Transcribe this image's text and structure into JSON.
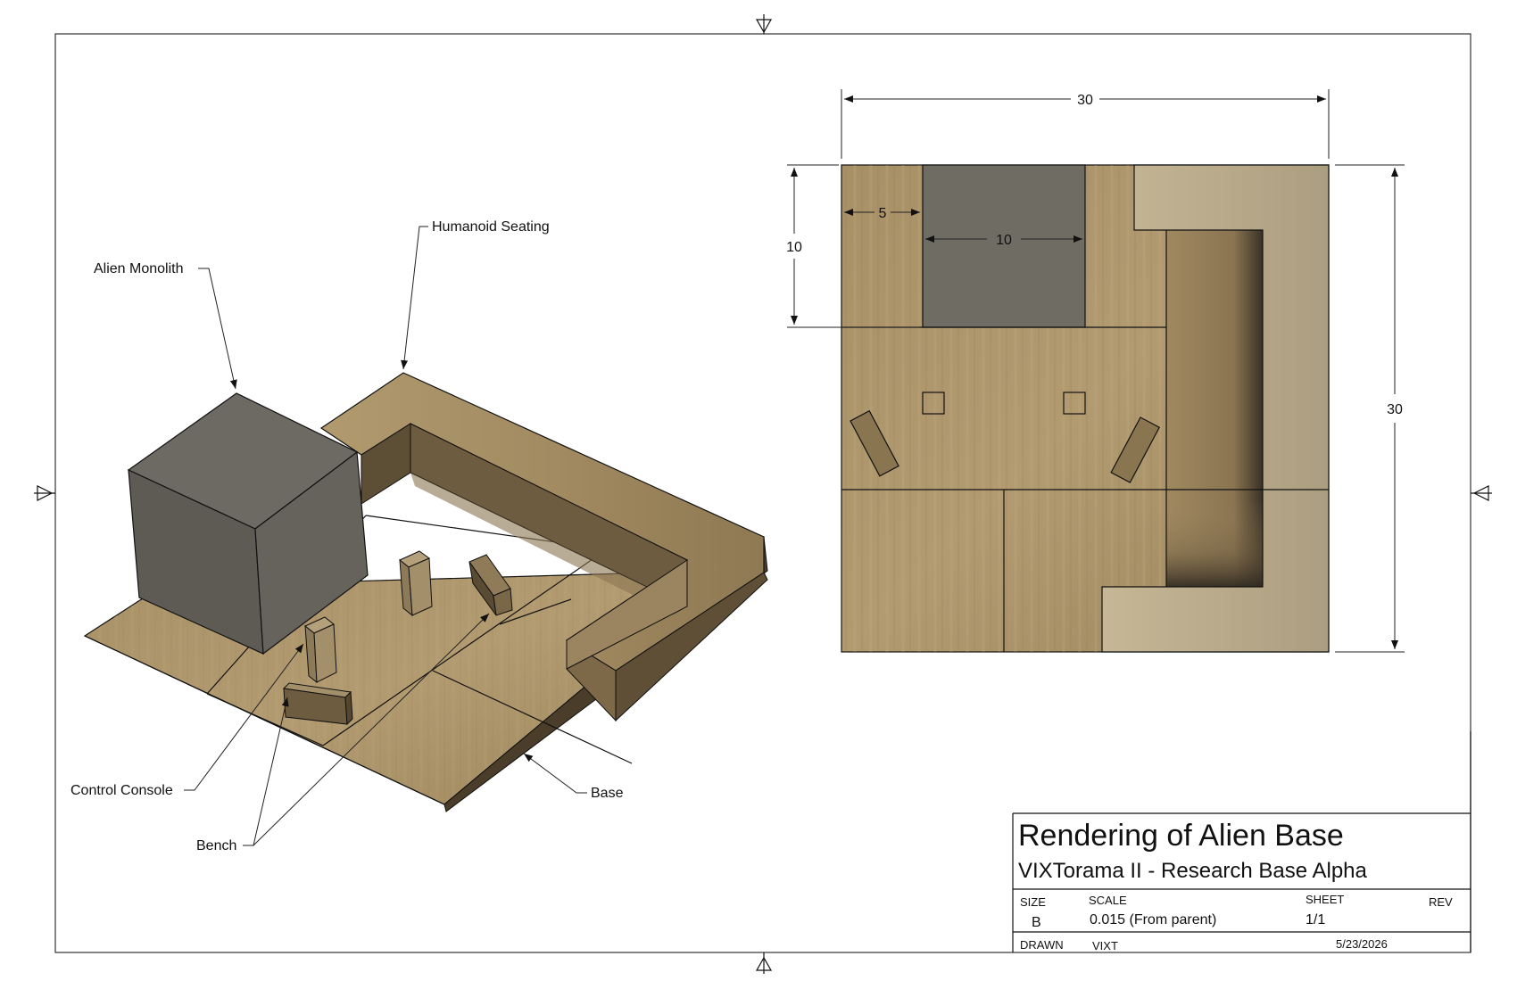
{
  "drawing": {
    "title": "Rendering of Alien Base",
    "subtitle": "VIXTorama II - Research Base Alpha"
  },
  "callouts": {
    "alien_monolith": "Alien Monolith",
    "humanoid_seating": "Humanoid Seating",
    "control_console": "Control Console",
    "bench": "Bench",
    "base": "Base"
  },
  "dimensions": {
    "overall_width": "30",
    "overall_height": "30",
    "monolith_depth": "10",
    "monolith_width": "10",
    "monolith_offset": "5"
  },
  "title_block": {
    "size_label": "SIZE",
    "size_value": "B",
    "scale_label": "SCALE",
    "scale_value": "0.015 (From parent)",
    "sheet_label": "SHEET",
    "sheet_value": "1/1",
    "rev_label": "REV",
    "drawn_label": "DRAWN",
    "drawn_value": "VIXT",
    "date_value": "5/23/2026"
  },
  "colors": {
    "wood": "#a58d63",
    "wood_dark": "#7d6847",
    "monolith": "#6f6c64",
    "seating_top": "#b3a588"
  }
}
